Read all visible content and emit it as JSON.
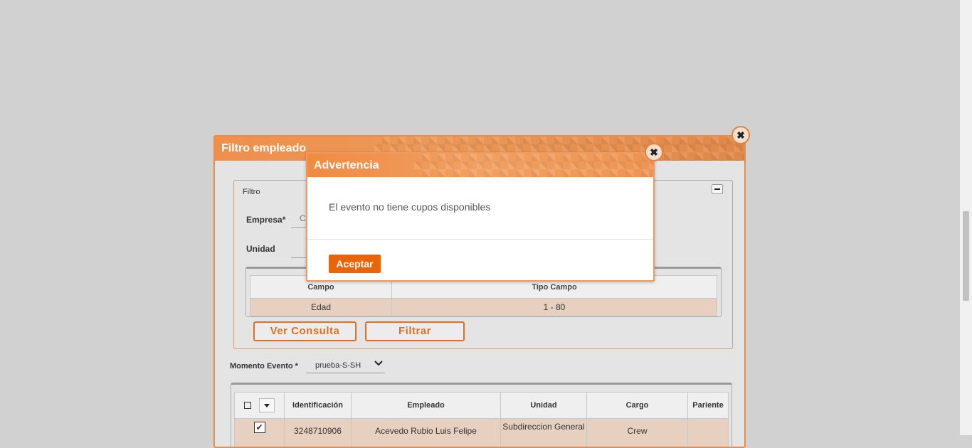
{
  "outer_dialog": {
    "title": "Filtro empleado",
    "close_glyph": "✖",
    "filter_section": {
      "legend": "Filtro",
      "empresa_label": "Empresa*",
      "empresa_value": "C/",
      "unidad_label": "Unidad",
      "criteria_table": {
        "headers": [
          "Campo",
          "Tipo Campo"
        ],
        "rows": [
          [
            "Edad",
            "1 - 80"
          ]
        ]
      },
      "ver_consulta_label": "Ver Consulta",
      "filtrar_label": "Filtrar"
    },
    "momento_evento": {
      "label": "Momento Evento *",
      "selected": "prueba-S-SH"
    },
    "employee_table": {
      "headers": [
        "Identificación",
        "Empleado",
        "Unidad",
        "Cargo",
        "Pariente"
      ],
      "rows": [
        {
          "checked": true,
          "identificacion": "3248710906",
          "empleado": "Acevedo Rubio Luis Felipe",
          "unidad": "Subdireccion General",
          "cargo": "Crew",
          "pariente": ""
        }
      ]
    }
  },
  "modal": {
    "title": "Advertencia",
    "message": "El evento no tiene cupos disponibles",
    "accept_label": "Aceptar",
    "close_glyph": "✖"
  },
  "colors": {
    "accent": "#e8650c",
    "header_orange": "#ef8f4b",
    "row_highlight": "#e7d0c0",
    "backdrop": "#d1d1d1"
  }
}
